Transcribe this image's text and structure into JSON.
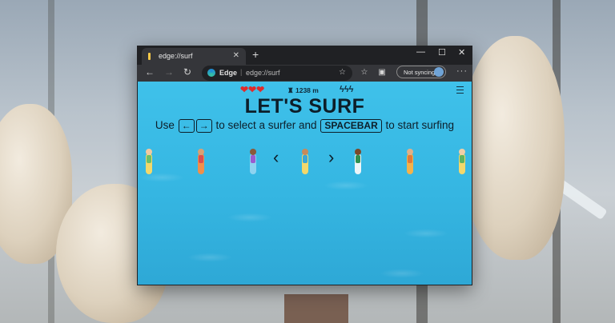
{
  "browser": {
    "tab": {
      "title": "edge://surf",
      "close": "✕"
    },
    "new_tab": "+",
    "window_controls": {
      "minimize": "—",
      "maximize": "☐",
      "close": "✕"
    },
    "nav": {
      "back": "←",
      "forward": "→",
      "refresh": "↻"
    },
    "address": {
      "site": "Edge",
      "separator": "|",
      "url": "edge://surf"
    },
    "sync_button": "Not syncing",
    "menu": "···"
  },
  "game": {
    "hud": {
      "hearts": "❤❤❤",
      "distance_icon": "♜",
      "distance": "1238 m",
      "boosts": "ϟϟϟ"
    },
    "title": "LET'S SURF",
    "instructions": {
      "use": "Use",
      "left_key": "←",
      "right_key": "→",
      "middle": "to select a surfer and",
      "space_key": "SPACEBAR",
      "end": "to start surfing"
    },
    "selector": {
      "prev": "‹",
      "next": "›"
    },
    "surfers": [
      {
        "board": "#f2d86b",
        "skin": "#f2c9a0",
        "body": "#6bbf6b"
      },
      {
        "board": "#f08f4a",
        "skin": "#d9a074",
        "body": "#d94f4f"
      },
      {
        "board": "#8ed3f0",
        "skin": "#8a5a3a",
        "body": "#9a5bd0"
      },
      {
        "board": "#f2d86b",
        "skin": "#c68a5a",
        "body": "#3aa7d6"
      },
      {
        "board": "#eef5f8",
        "skin": "#7a4a2a",
        "body": "#2f8f4f"
      },
      {
        "board": "#f4b24a",
        "skin": "#e0b088",
        "body": "#e07a3a"
      },
      {
        "board": "#f2d86b",
        "skin": "#f0cfa8",
        "body": "#5fb35f"
      }
    ],
    "colors": {
      "water": "#3fc1ea",
      "text": "#0d1e29",
      "heart": "#e02a2a"
    }
  }
}
